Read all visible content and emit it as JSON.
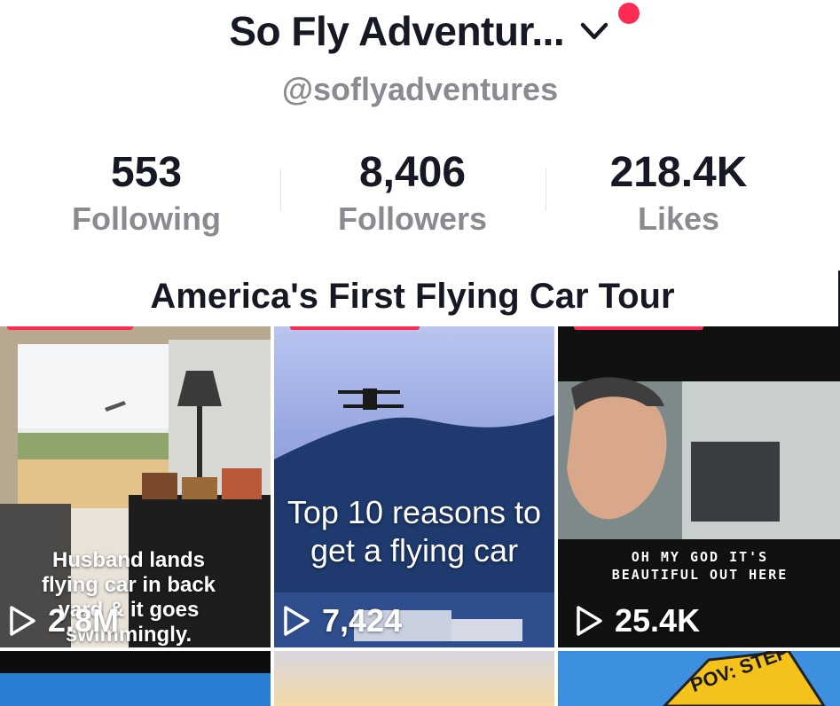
{
  "profile": {
    "name": "So Fly Adventur...",
    "handle": "@soflyadventures",
    "notification_color": "#fe2c55"
  },
  "stats": [
    {
      "value": "553",
      "label": "Following"
    },
    {
      "value": "8,406",
      "label": "Followers"
    },
    {
      "value": "218.4K",
      "label": "Likes"
    }
  ],
  "playlist": {
    "title": "America's First Flying Car Tour"
  },
  "videos": [
    {
      "caption": "Husband lands flying car in back yard & it goes swimmingly.",
      "views": "2.8M"
    },
    {
      "caption": "Top 10 reasons to get a flying car",
      "views": "7,424"
    },
    {
      "caption": "OH MY GOD IT'S BEAUTIFUL OUT HERE",
      "views": "25.4K"
    },
    {
      "caption": "",
      "views": ""
    },
    {
      "caption": "",
      "views": ""
    },
    {
      "caption": "POV: STEP",
      "views": ""
    }
  ],
  "icons": [
    "chevron-down-icon",
    "play-icon"
  ]
}
